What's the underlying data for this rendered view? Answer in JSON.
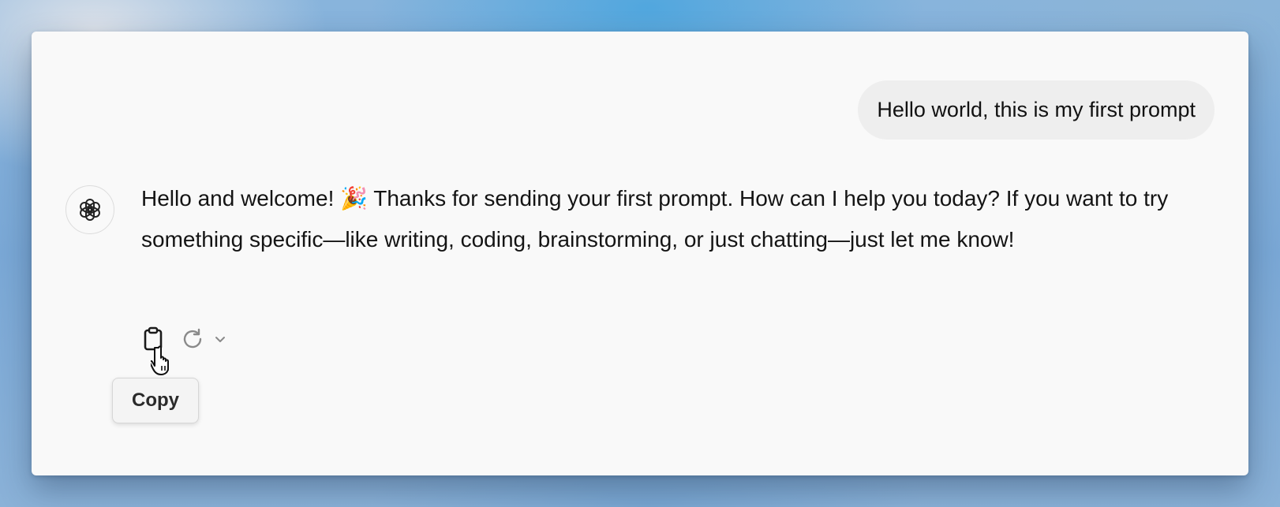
{
  "conversation": {
    "user_message": "Hello world, this is my first prompt",
    "assistant_message": "Hello and welcome! 🎉 Thanks for sending your first prompt. How can I help you today? If you want to try something specific—like writing, coding, brainstorming, or just chatting—just let me know!"
  },
  "actions": {
    "copy_icon": "clipboard-icon",
    "regenerate_icon": "refresh-icon",
    "more_icon": "chevron-down-icon",
    "tooltip": "Copy"
  },
  "assistant": {
    "avatar_icon": "openai-logo-icon"
  }
}
